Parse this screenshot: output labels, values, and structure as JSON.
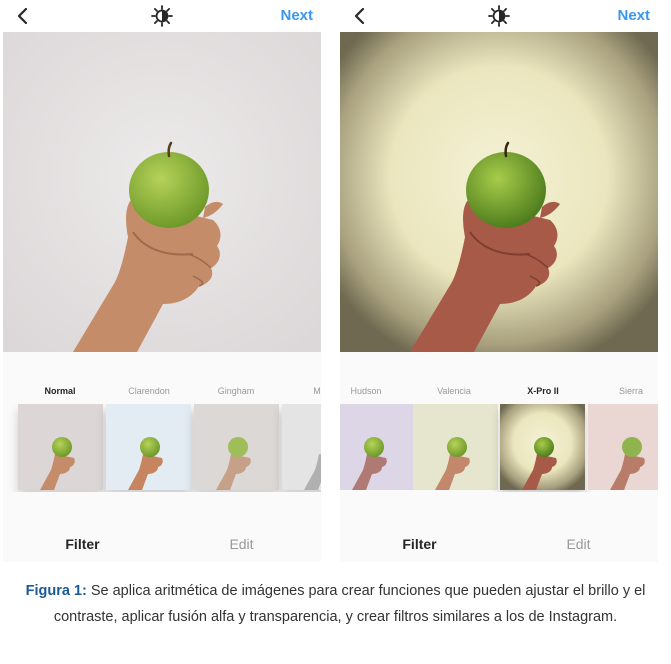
{
  "screens": [
    {
      "next_label": "Next",
      "filters": [
        {
          "label": "Normal",
          "active": true
        },
        {
          "label": "Clarendon",
          "active": false
        },
        {
          "label": "Gingham",
          "active": false
        },
        {
          "label": "M",
          "active": false
        }
      ],
      "tabs": {
        "filter": "Filter",
        "edit": "Edit"
      }
    },
    {
      "next_label": "Next",
      "filters": [
        {
          "label": "Hudson",
          "active": false
        },
        {
          "label": "Valencia",
          "active": false
        },
        {
          "label": "X-Pro II",
          "active": true
        },
        {
          "label": "Sierra",
          "active": false
        }
      ],
      "tabs": {
        "filter": "Filter",
        "edit": "Edit"
      }
    }
  ],
  "caption": {
    "label": "Figura 1:",
    "text": " Se aplica aritmética de imágenes para crear funciones que pueden ajustar el brillo y el contraste, aplicar fusión alfa y transparencia, y crear filtros similares a los de Instagram."
  },
  "colors": {
    "accent": "#3897f0",
    "caption_label": "#1a5a96"
  },
  "icons": {
    "back": "chevron-left-icon",
    "brightness": "brightness-icon"
  }
}
